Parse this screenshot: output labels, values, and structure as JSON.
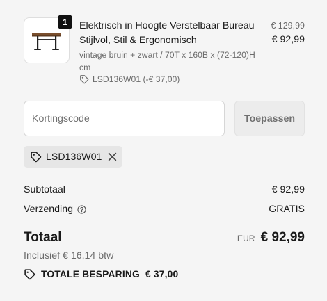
{
  "product": {
    "quantity": "1",
    "title": "Elektrisch in Hoogte Verstelbaar Bureau – Stijlvol, Stil & Ergonomisch",
    "variant": "vintage bruin + zwart / 70T x 160B x (72-120)H cm",
    "discount_line": "LSD136W01 (-€ 37,00)",
    "old_price": "€ 129,99",
    "new_price": "€ 92,99",
    "image_icon": "standing-desk-icon"
  },
  "discount": {
    "placeholder": "Kortingscode",
    "apply_label": "Toepassen",
    "applied_code": "LSD136W01"
  },
  "summary": {
    "subtotal_label": "Subtotaal",
    "subtotal_value": "€ 92,99",
    "shipping_label": "Verzending",
    "shipping_value": "GRATIS",
    "total_label": "Totaal",
    "currency": "EUR",
    "total_value": "€ 92,99",
    "tax_note": "Inclusief € 16,14 btw",
    "savings_label": "TOTALE BESPARING",
    "savings_value": "€ 37,00"
  },
  "colors": {
    "background": "#f5f5f5",
    "text": "#1a1a1a",
    "muted": "#6b6b6b",
    "badge": "#111111"
  }
}
